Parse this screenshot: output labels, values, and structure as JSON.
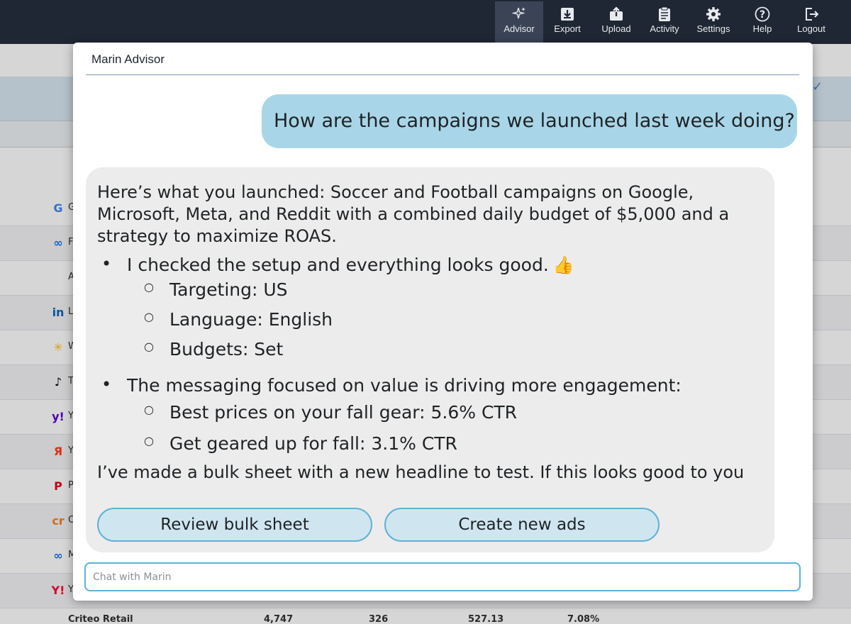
{
  "nav": {
    "items": [
      {
        "label": "Advisor",
        "icon": "sparkle-icon",
        "active": true
      },
      {
        "label": "Export",
        "icon": "download-icon",
        "active": false
      },
      {
        "label": "Upload",
        "icon": "upload-icon",
        "active": false
      },
      {
        "label": "Activity",
        "icon": "clipboard-icon",
        "active": false
      },
      {
        "label": "Settings",
        "icon": "gear-icon",
        "active": false
      },
      {
        "label": "Help",
        "icon": "help-icon",
        "active": false
      },
      {
        "label": "Logout",
        "icon": "logout-icon",
        "active": false
      }
    ]
  },
  "background": {
    "rows": [
      {
        "logo": "G",
        "color": "#4285f4",
        "text": "G"
      },
      {
        "logo": "∞",
        "color": "#1877f2",
        "text": "F"
      },
      {
        "logo": "",
        "color": "#000000",
        "text": "A"
      },
      {
        "logo": "in",
        "color": "#0a66c2",
        "text": "L"
      },
      {
        "logo": "✳",
        "color": "#ffc220",
        "text": "W"
      },
      {
        "logo": "♪",
        "color": "#000000",
        "text": "T"
      },
      {
        "logo": "y!",
        "color": "#6001d2",
        "text": "Y"
      },
      {
        "logo": "Я",
        "color": "#fc3f1d",
        "text": "Y"
      },
      {
        "logo": "P",
        "color": "#e60023",
        "text": "P"
      },
      {
        "logo": "cr",
        "color": "#f48120",
        "text": "C"
      },
      {
        "logo": "∞",
        "color": "#1877f2",
        "text": "M"
      },
      {
        "logo": "Y!",
        "color": "#ff0033",
        "text": "Y"
      }
    ],
    "bottom_row": {
      "name": "Criteo Retail",
      "values": [
        "4,747",
        "326",
        "527.13",
        "7.08%"
      ]
    }
  },
  "modal": {
    "title": "Marin Advisor",
    "user_message": "How are the campaigns we launched last week doing?",
    "bot": {
      "intro": "Here’s what you launched: Soccer and Football campaigns on Google, Microsoft, Meta, and Reddit with a combined daily budget of $5,000 and a strategy to maximize ROAS.",
      "bullet1": "I checked the setup and everything looks good.",
      "bullet1_emoji": "👍",
      "bullet1_subs": [
        "Targeting: US",
        "Language: English",
        "Budgets: Set"
      ],
      "bullet2": "The messaging focused on value is driving more engagement:",
      "bullet2_subs": [
        "Best prices on your fall gear: 5.6% CTR",
        "Get geared up for fall: 3.1% CTR"
      ],
      "closing": "I’ve made a bulk sheet with a new headline to test. If this looks good to you"
    },
    "actions": {
      "review": "Review bulk sheet",
      "create": "Create new ads"
    },
    "input_placeholder": "Chat with Marin"
  }
}
